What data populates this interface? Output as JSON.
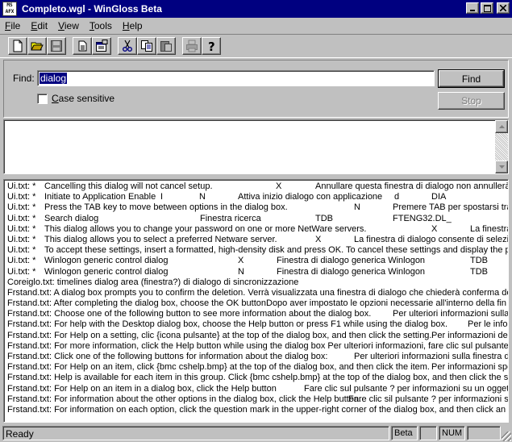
{
  "window": {
    "title": "Completo.wgl - WinGloss Beta",
    "icon_text": [
      "MS",
      "AFX"
    ],
    "controls": [
      "minimize",
      "maximize",
      "close"
    ]
  },
  "menu": {
    "items": [
      {
        "label": "File",
        "u": "F",
        "rest": "ile"
      },
      {
        "label": "Edit",
        "u": "E",
        "rest": "dit"
      },
      {
        "label": "View",
        "u": "V",
        "rest": "iew"
      },
      {
        "label": "Tools",
        "u": "T",
        "rest": "ools"
      },
      {
        "label": "Help",
        "u": "H",
        "rest": "elp"
      }
    ]
  },
  "toolbar": {
    "buttons": [
      "new-icon",
      "open-icon",
      "save-icon",
      "page-icon",
      "properties-icon",
      "cut-icon",
      "copy-icon",
      "paste-icon",
      "print-icon",
      "help-icon"
    ]
  },
  "find": {
    "label": "Find:",
    "value": "dialog",
    "find_button": "Find",
    "stop_button": "Stop",
    "case_sensitive_label": "Case sensitive",
    "case_sensitive_checked": false
  },
  "results": [
    [
      "Ui.txt: *",
      "Cancelling this dialog will not cancel setup.",
      "X",
      "Annullare questa finestra di dialogo non annullerà l'"
    ],
    [
      "Ui.txt: *",
      "Initiate to Application Enable",
      "I",
      "N",
      "Attiva inizio dialogo con applicazione",
      "d",
      "DIA"
    ],
    [
      "Ui.txt: *",
      "Press the TAB key to move between options in the dialog box.",
      "N",
      "Premere TAB per spostarsi tra"
    ],
    [
      "Ui.txt: *",
      "Search dialog",
      "Finestra ricerca",
      "TDB",
      "FTENG32.DL_"
    ],
    [
      "Ui.txt: *",
      "This dialog allows you to change your password on one or more NetWare servers.",
      "X",
      "La finestra"
    ],
    [
      "Ui.txt: *",
      "This dialog allows you to select a preferred Netware server.",
      "X",
      "La finestra di dialogo consente di selezio"
    ],
    [
      "Ui.txt: *",
      "To accept these settings, insert a formatted, high-density disk and press OK. To cancel these settings and display the prev"
    ],
    [
      "Ui.txt: *",
      "Winlogon generic control dialog",
      "X",
      "Finestra di dialogo generica Winlogon",
      "TDB"
    ],
    [
      "Ui.txt: *",
      "Winlogon generic control dialog",
      "N",
      "Finestra di dialogo generica Winlogon",
      "TDB"
    ],
    [
      "Coreiglo.txt: timelines dialog    area (finestra?) di dialogo di sincronizzazione"
    ],
    [
      "Frstand.txt: A dialog box prompts you to confirm the deletion. Verrà visualizzata una finestra di dialogo che chiederà conferma dell'elir"
    ],
    [
      "Frstand.txt: After completing the dialog box, choose the OK button.",
      "Dopo aver impostato le opzioni necessarie all'interno della fin"
    ],
    [
      "Frstand.txt: Choose one of the following button to see more information about the dialog box.",
      "Per ulteriori informazioni sulla fi"
    ],
    [
      "Frstand.txt: For help with the Desktop dialog box, choose the Help button or press F1 while using the dialog box.",
      "Per le info"
    ],
    [
      "Frstand.txt: For Help on a setting, clic {icona pulsante} at the top of the dialog box, and then click the setting.",
      "Per informazioni dell"
    ],
    [
      "Frstand.txt: For more information, click the Help button while using the dialog box Per ulteriori informazioni, fare clic sul pulsante ? all'i"
    ],
    [
      "Frstand.txt: Click one of the following buttons for information about the dialog box:",
      "Per ulteriori informazioni sulla finestra di d"
    ],
    [
      "Frstand.txt: For Help on an item, click {bmc cshelp.bmp} at the top of the dialog box, and then click the item.",
      "Per informazioni speci"
    ],
    [
      "Frstand.txt: Help is available for each item in this group. Click {bmc cshelp.bmp} at the top of the dialog box, and then click the speci"
    ],
    [
      "Frstand.txt: For Help on an item in a dialog box, click the Help button",
      "Fare clic sul pulsante ? per informazioni su un oggetto di una"
    ],
    [
      "Frstand.txt: For information about the other options in the dialog box, click the Help button.",
      "Fare clic sil pulsante ? per informazioni su"
    ],
    [
      "Frstand.txt: For information on each option, click the question mark in the upper-right corner of the dialog box, and then click an optic"
    ]
  ],
  "status": {
    "text": "Ready",
    "panels": [
      "Beta",
      "",
      "NUM",
      ""
    ]
  }
}
